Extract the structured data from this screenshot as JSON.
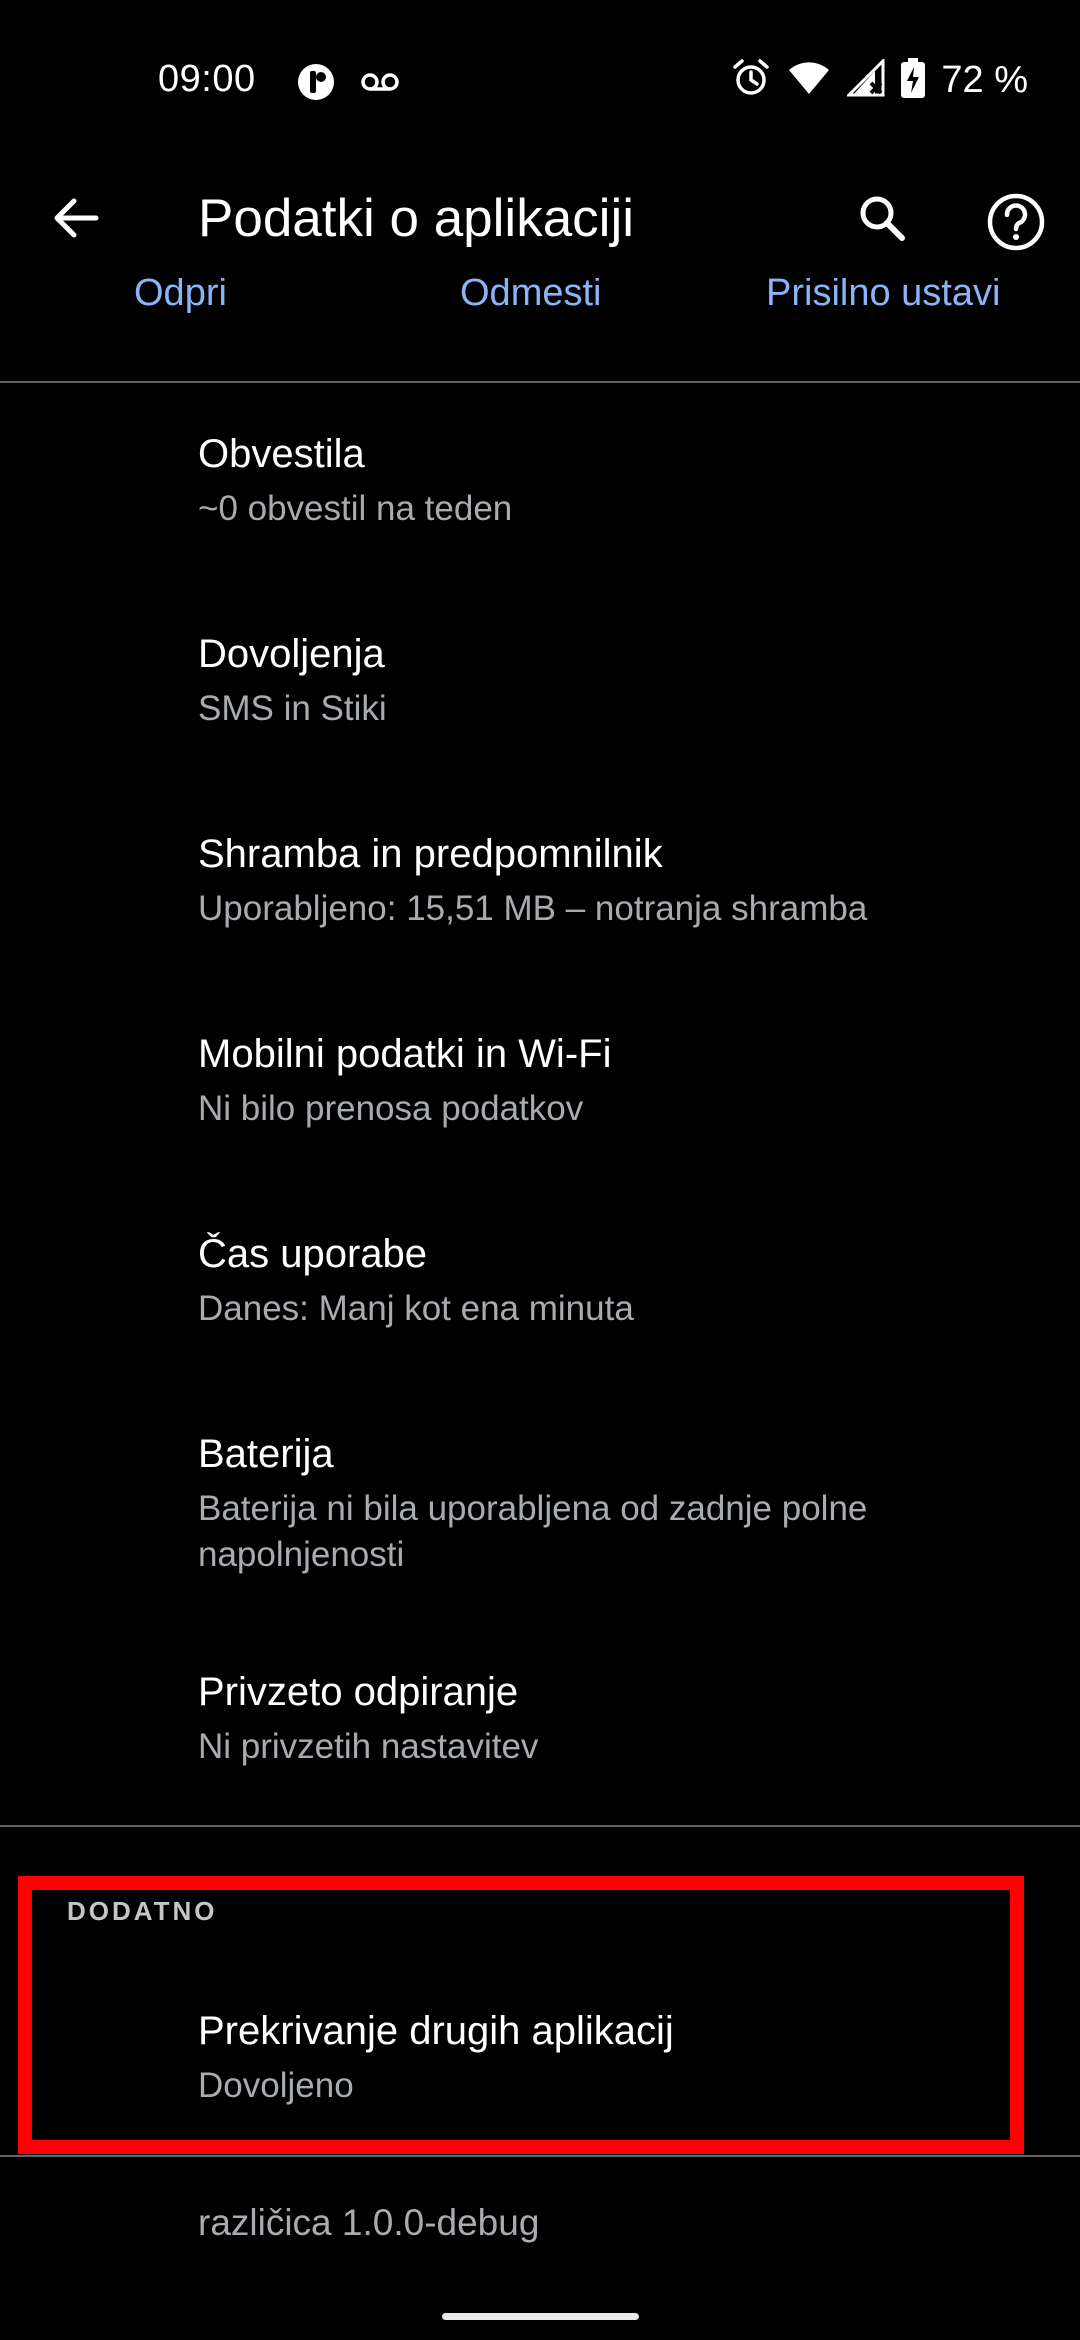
{
  "status_bar": {
    "time": "09:00",
    "left_icons": [
      "app-notification-icon",
      "voicemail-icon"
    ],
    "right_icons": [
      "alarm-icon",
      "wifi-icon",
      "cell-signal-no-data-icon",
      "battery-charging-icon"
    ],
    "battery_text": "72 %"
  },
  "app_bar": {
    "title": "Podatki o aplikaciji"
  },
  "actions": {
    "open_label": "Odpri",
    "uninstall_label": "Odmesti",
    "force_stop_label": "Prisilno ustavi"
  },
  "settings": [
    {
      "title": "Obvestila",
      "subtitle": "~0 obvestil na teden"
    },
    {
      "title": "Dovoljenja",
      "subtitle": "SMS in Stiki"
    },
    {
      "title": "Shramba in predpomnilnik",
      "subtitle": "Uporabljeno: 15,51 MB – notranja shramba"
    },
    {
      "title": "Mobilni podatki in Wi-Fi",
      "subtitle": "Ni bilo prenosa podatkov"
    },
    {
      "title": "Čas uporabe",
      "subtitle": "Danes: Manj kot ena minuta"
    },
    {
      "title": "Baterija",
      "subtitle": "Baterija ni bila uporabljena od zadnje polne napolnjenosti"
    },
    {
      "title": "Privzeto odpiranje",
      "subtitle": "Ni privzetih nastavitev"
    }
  ],
  "advanced": {
    "header": "DODATNO",
    "overlay": {
      "title": "Prekrivanje drugih aplikacij",
      "subtitle": "Dovoljeno"
    }
  },
  "version_text": "različica 1.0.0-debug",
  "colors": {
    "background": "#000000",
    "accent_link": "#8ab4f8",
    "highlight": "#ff0000",
    "secondary_text": "#a8abb0"
  }
}
